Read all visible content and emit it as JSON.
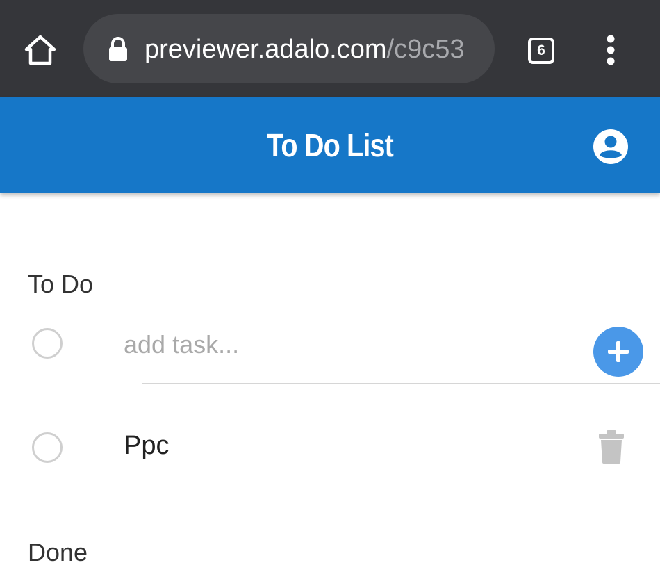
{
  "browser": {
    "url_host": "previewer.adalo.com",
    "url_path": "/c9c53",
    "tab_count": "6",
    "icons": {
      "home": "home-icon",
      "lock": "lock-icon",
      "tabs": "tab-switcher-icon",
      "menu": "more-vert-icon"
    }
  },
  "header": {
    "title": "To Do List",
    "color": "#1677c8",
    "profile_icon": "account-circle-icon"
  },
  "todo_section": {
    "title": "To Do",
    "add_input": {
      "placeholder": "add task...",
      "value": ""
    },
    "add_button_icon": "plus-icon",
    "add_button_color": "#4a98e8",
    "tasks": [
      {
        "label": "Ppc",
        "done": false,
        "delete_icon": "trash-icon"
      }
    ]
  },
  "done_section": {
    "title": "Done"
  }
}
